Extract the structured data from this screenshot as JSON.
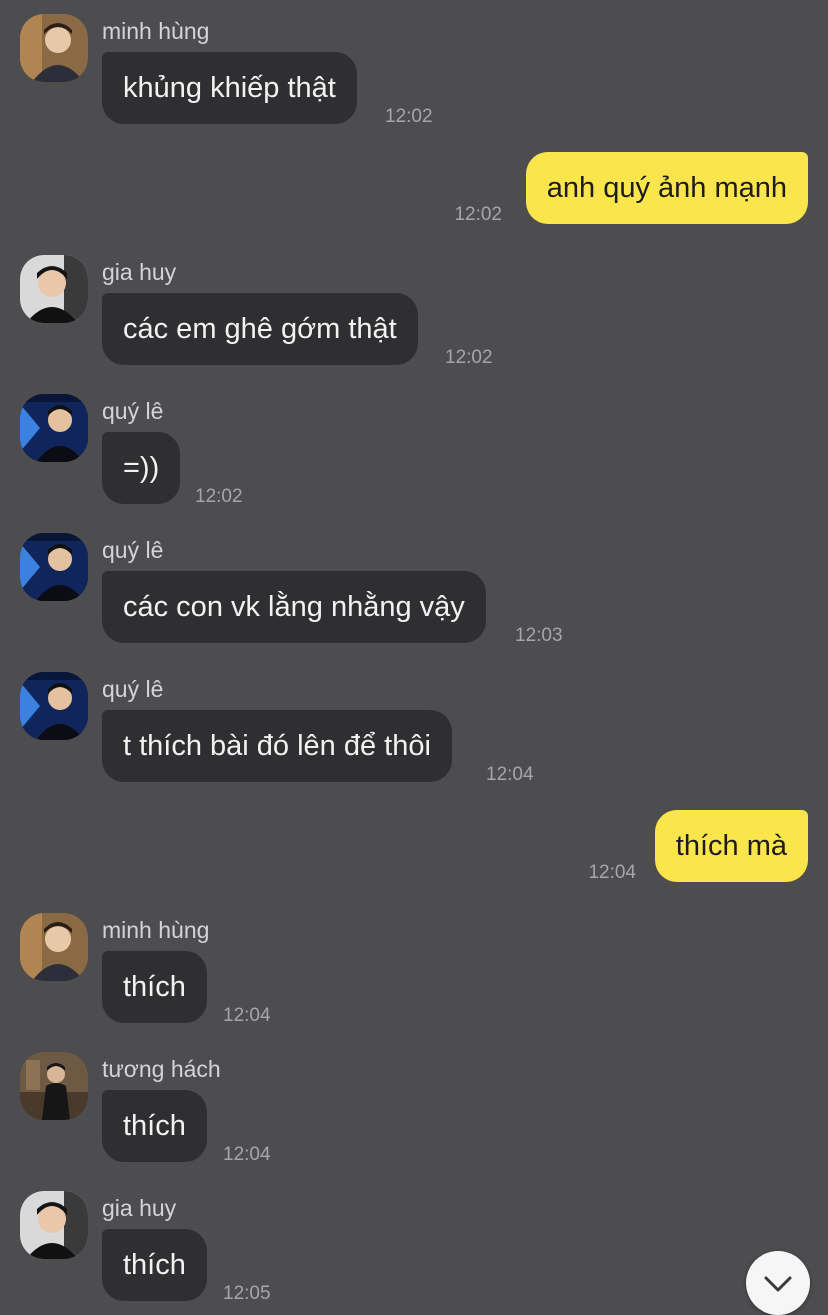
{
  "colors": {
    "background": "#4d4d4f",
    "incoming_bubble": "#2f2f31",
    "outgoing_bubble": "#fae64c",
    "timestamp": "#a6a6a8"
  },
  "messages": [
    {
      "sender": "minh hùng",
      "text": "khủng khiếp thật",
      "time": "12:02"
    },
    {
      "text": "anh quý ảnh mạnh",
      "time": "12:02",
      "outgoing": true
    },
    {
      "sender": "gia huy",
      "text": "các em ghê gớm thật",
      "time": "12:02"
    },
    {
      "sender": "quý lê",
      "text": "=))",
      "time": "12:02"
    },
    {
      "sender": "quý lê",
      "text": "các con vk lằng nhằng vậy",
      "time": "12:03"
    },
    {
      "sender": "quý lê",
      "text": "t thích bài đó lên để thôi",
      "time": "12:04"
    },
    {
      "text": "thích mà",
      "time": "12:04",
      "outgoing": true
    },
    {
      "sender": "minh hùng",
      "text": "thích",
      "time": "12:04"
    },
    {
      "sender": "tương hách",
      "text": "thích",
      "time": "12:04"
    },
    {
      "sender": "gia huy",
      "text": "thích",
      "time": "12:05"
    }
  ],
  "scroll_button": {
    "icon": "chevron-down-icon"
  }
}
